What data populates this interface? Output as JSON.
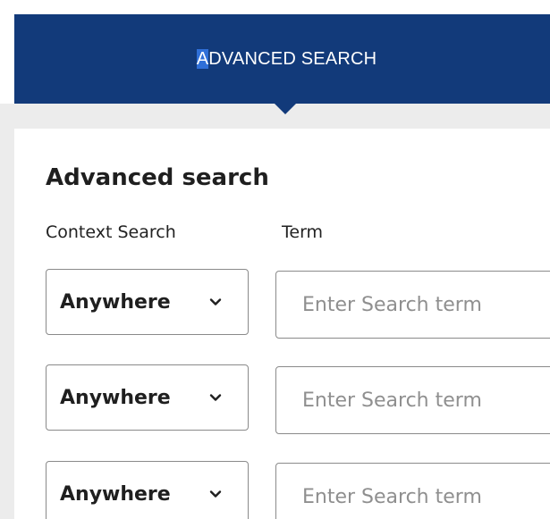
{
  "header": {
    "title_first": "A",
    "title_rest": "DVANCED SEARCH"
  },
  "panel": {
    "title": "Advanced search",
    "context_label": "Context Search",
    "term_label": "Term"
  },
  "rows": [
    {
      "context_value": "Anywhere",
      "term_placeholder": "Enter Search term",
      "term_value": ""
    },
    {
      "context_value": "Anywhere",
      "term_placeholder": "Enter Search term",
      "term_value": ""
    },
    {
      "context_value": "Anywhere",
      "term_placeholder": "Enter Search term",
      "term_value": ""
    }
  ],
  "colors": {
    "header_bg": "#123a7a",
    "selection": "#2f6fd8",
    "page_grey": "#ececec",
    "border": "#8a8a8a"
  },
  "icons": {
    "dropdown": "chevron-down-icon"
  }
}
